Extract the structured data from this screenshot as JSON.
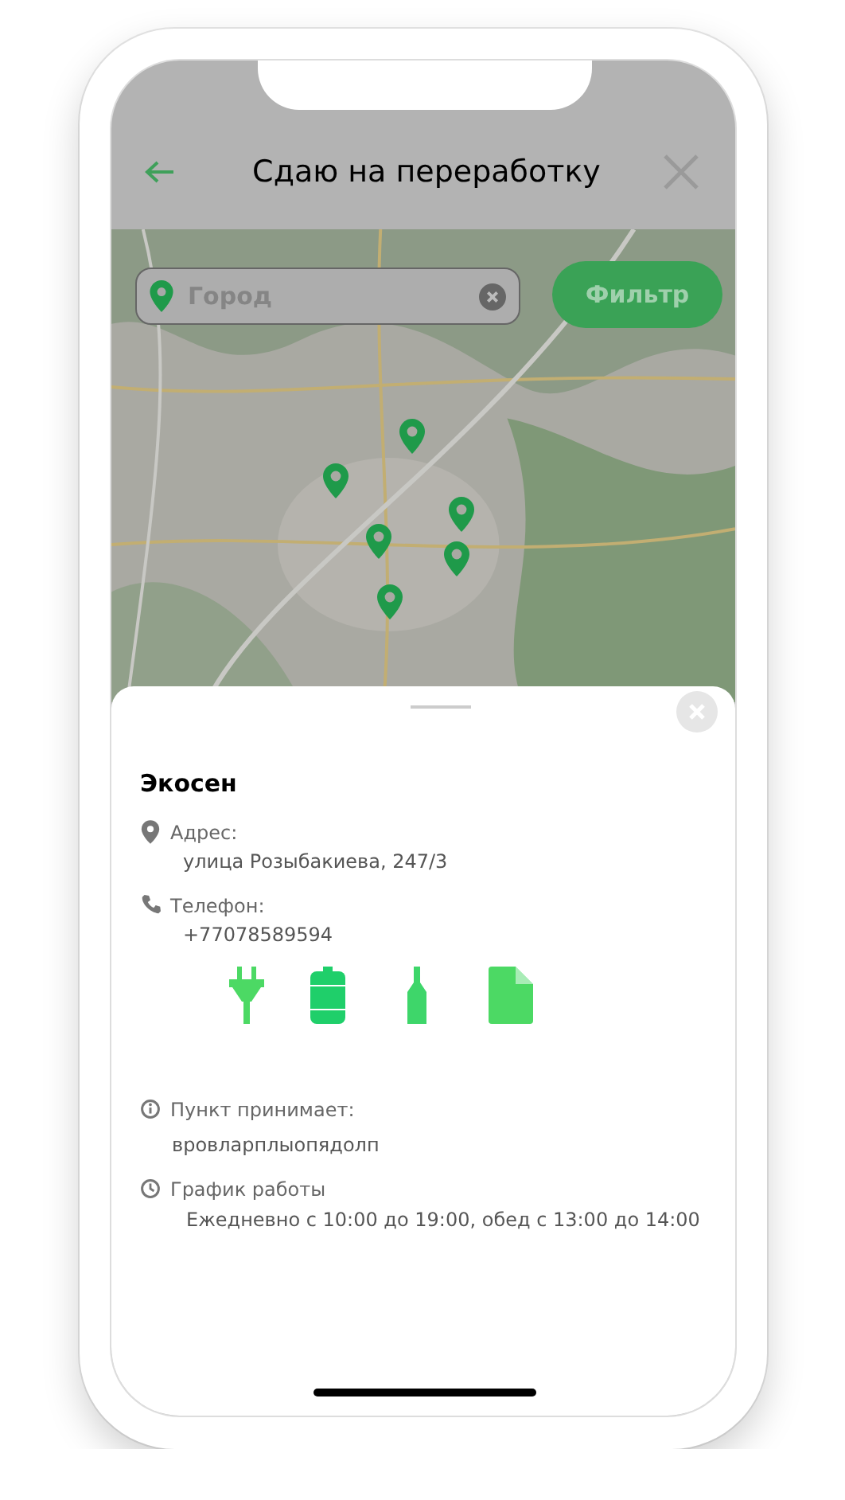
{
  "header": {
    "title": "Сдаю на переработку"
  },
  "search": {
    "placeholder": "Город"
  },
  "filter_button": {
    "label": "Фильтр"
  },
  "point": {
    "name": "Экосен",
    "details": [
      {
        "kind": "address",
        "label": "Адрес:",
        "value": "улица Розыбакиева, 247/3"
      },
      {
        "kind": "phone",
        "label": "Телефон:",
        "value": "+77078589594"
      }
    ],
    "materials": [
      {
        "kind": "plug"
      },
      {
        "kind": "can"
      },
      {
        "kind": "bottle"
      },
      {
        "kind": "paper"
      }
    ],
    "info": [
      {
        "kind": "accepts",
        "label": "Пункт принимает:",
        "value": "вровларплыопядолп"
      },
      {
        "kind": "schedule",
        "label": "График работы",
        "value": "Ежедневно с 10:00 до 19:00, обед с 13:00 до 14:00"
      }
    ]
  }
}
